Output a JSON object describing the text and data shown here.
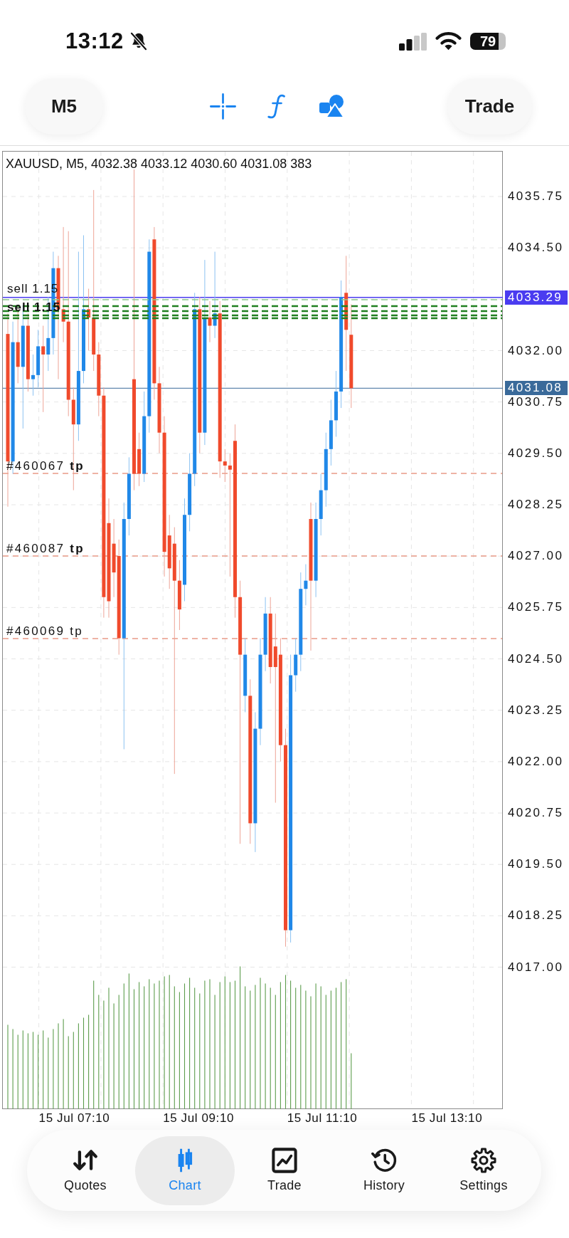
{
  "status_bar": {
    "time": "13:12",
    "battery": "79"
  },
  "toolbar": {
    "timeframe": "M5",
    "trade_button": "Trade"
  },
  "chart": {
    "header": "XAUUSD, M5, 4032.38 4033.12 4030.60 4031.08 383",
    "order_labels": [
      {
        "text": "sell 1.15",
        "kind": "single"
      },
      {
        "text": "sell 1.15",
        "kind": "stacked"
      }
    ],
    "tp_labels": [
      "#460067 **tp**",
      "#460087 **tp**",
      "#460069 tp"
    ],
    "price_tags": [
      {
        "text": "4033.29",
        "color": "#4a3cf0"
      },
      {
        "text": "4031.08",
        "color": "#3a6a9a"
      }
    ],
    "price_axis": [
      "4035.75",
      "4034.50",
      "4032.00",
      "4030.75",
      "4029.50",
      "4028.25",
      "4027.00",
      "4025.75",
      "4024.50",
      "4023.25",
      "4022.00",
      "4020.75",
      "4019.50",
      "4018.25",
      "4017.00"
    ],
    "time_axis": [
      "15 Jul 07:10",
      "15 Jul 09:10",
      "15 Jul 11:10",
      "15 Jul 13:10"
    ]
  },
  "nav": [
    {
      "label": "Quotes",
      "selected": false
    },
    {
      "label": "Chart",
      "selected": true
    },
    {
      "label": "Trade",
      "selected": false
    },
    {
      "label": "History",
      "selected": false
    },
    {
      "label": "Settings",
      "selected": false
    }
  ]
}
